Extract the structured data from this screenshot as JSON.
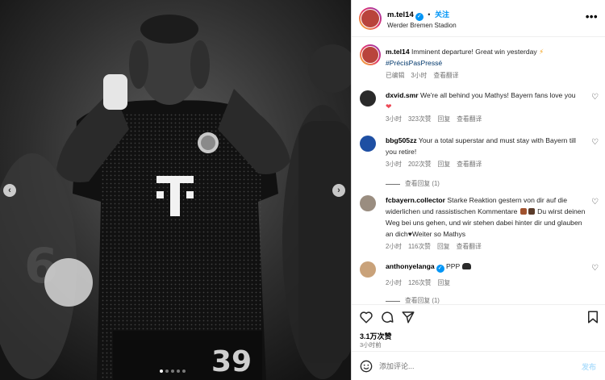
{
  "post": {
    "username": "m.tel14",
    "follow_label": "关注",
    "location": "Werder Bremen Stadion",
    "more_label": "•••"
  },
  "caption": {
    "username": "m.tel14",
    "text": "Imminent departure! Great win yesterday",
    "hashtag": "#PrécisPasPressé",
    "edited": "已编辑",
    "time": "3小时",
    "translate": "查看翻译"
  },
  "comments": [
    {
      "username": "dxvid.smr",
      "text": "We're all behind you Mathys! Bayern fans love you",
      "time": "3小时",
      "likes": "323次赞",
      "reply": "回复",
      "translate": "查看翻译"
    },
    {
      "username": "bbg505zz",
      "text": "Your a total superstar and must stay with Bayern till you retire!",
      "time": "3小时",
      "likes": "202次赞",
      "reply": "回复",
      "translate": "查看翻译",
      "view_replies": "查看回复 (1)"
    },
    {
      "username": "fcbayern.collector",
      "text_a": "Starke Reaktion gestern von dir auf die widerlichen und rassistischen Kommentare",
      "text_b": "Du wirst deinen Weg bei uns gehen, und wir stehen dabei hinter dir und glauben an dich",
      "text_c": "Weiter so Mathys",
      "time": "2小时",
      "likes": "116次赞",
      "reply": "回复",
      "translate": "查看翻译"
    },
    {
      "username": "anthonyelanga",
      "text": "PPP",
      "time": "2小时",
      "likes": "126次赞",
      "reply": "回复",
      "view_replies": "查看回复 (1)"
    }
  ],
  "stats": {
    "likes": "3.1万次赞",
    "posted": "3小时前"
  },
  "composer": {
    "placeholder": "添加评论...",
    "post_label": "发布"
  },
  "colors": {
    "accent": "#0095f6",
    "muted": "#737373",
    "heart_red": "#ed4956"
  },
  "icons": [
    "heart-icon",
    "comment-icon",
    "share-icon",
    "bookmark-icon",
    "emoji-icon",
    "chevron-left-icon",
    "chevron-right-icon"
  ]
}
